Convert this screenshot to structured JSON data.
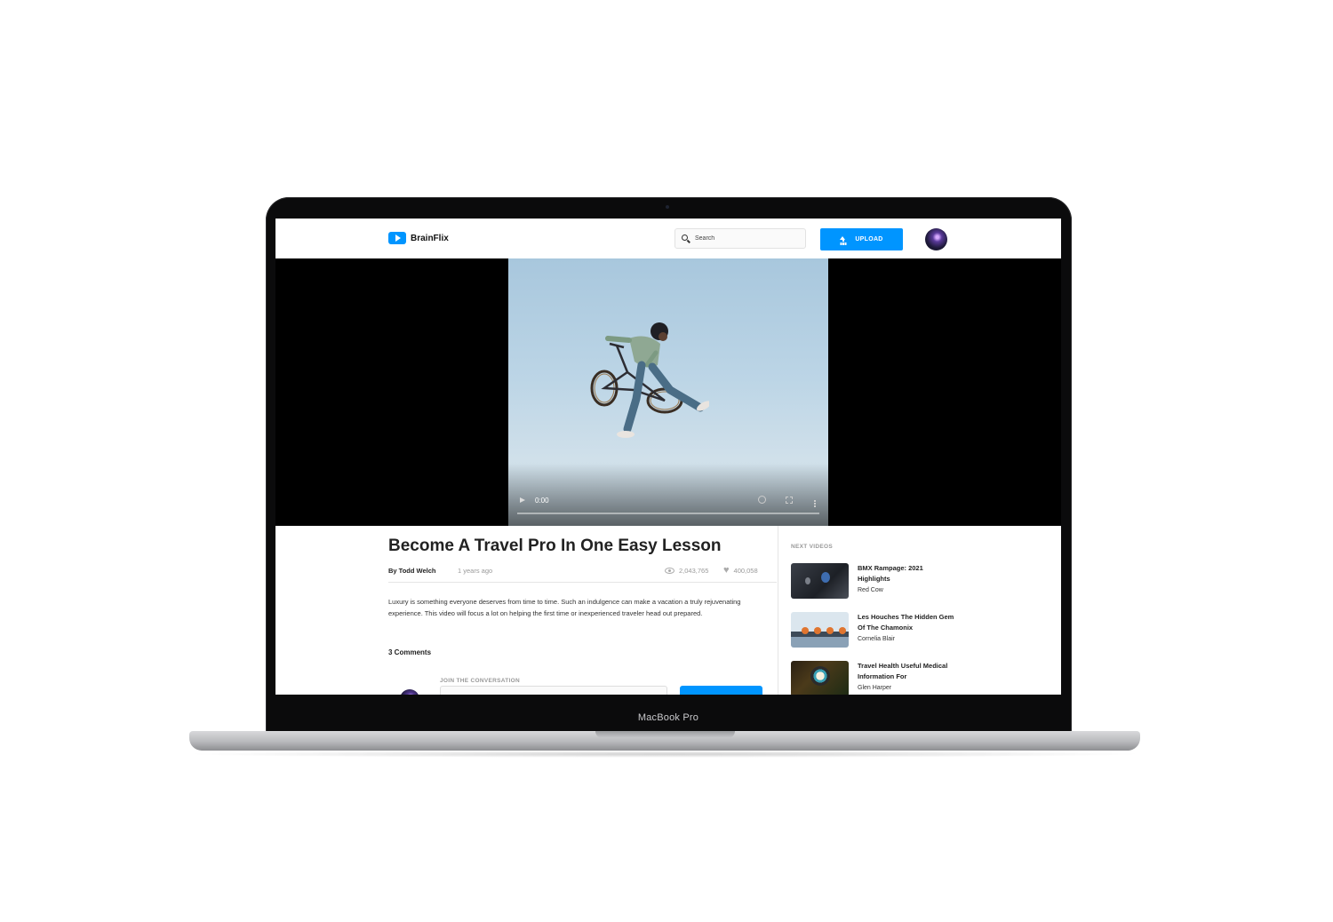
{
  "device": {
    "label": "MacBook Pro"
  },
  "header": {
    "logo_text": "BrainFlix",
    "search_placeholder": "Search",
    "upload_label": "UPLOAD"
  },
  "player": {
    "time": "0:00",
    "progress": 0
  },
  "video": {
    "title": "Become A Travel Pro In One Easy Lesson",
    "author": "By Todd Welch",
    "date": "1 years ago",
    "views": "2,043,765",
    "likes": "400,058",
    "description": "Luxury is something everyone deserves from time to time. Such an indulgence can make a vacation a truly rejuvenating experience. This video will focus a lot on helping the first time or inexperienced traveler head out prepared."
  },
  "comments": {
    "count_label": "3 Comments",
    "join_label": "JOIN THE CONVERSATION"
  },
  "next_videos": {
    "heading": "NEXT VIDEOS",
    "items": [
      {
        "title": "BMX Rampage: 2021 Highlights",
        "channel": "Red Cow"
      },
      {
        "title": "Les Houches The Hidden Gem Of The Chamonix",
        "channel": "Cornelia Blair"
      },
      {
        "title": "Travel Health Useful Medical Information For",
        "channel": "Glen Harper"
      }
    ]
  },
  "colors": {
    "accent": "#0095ff",
    "text": "#222222",
    "muted": "#999999"
  }
}
